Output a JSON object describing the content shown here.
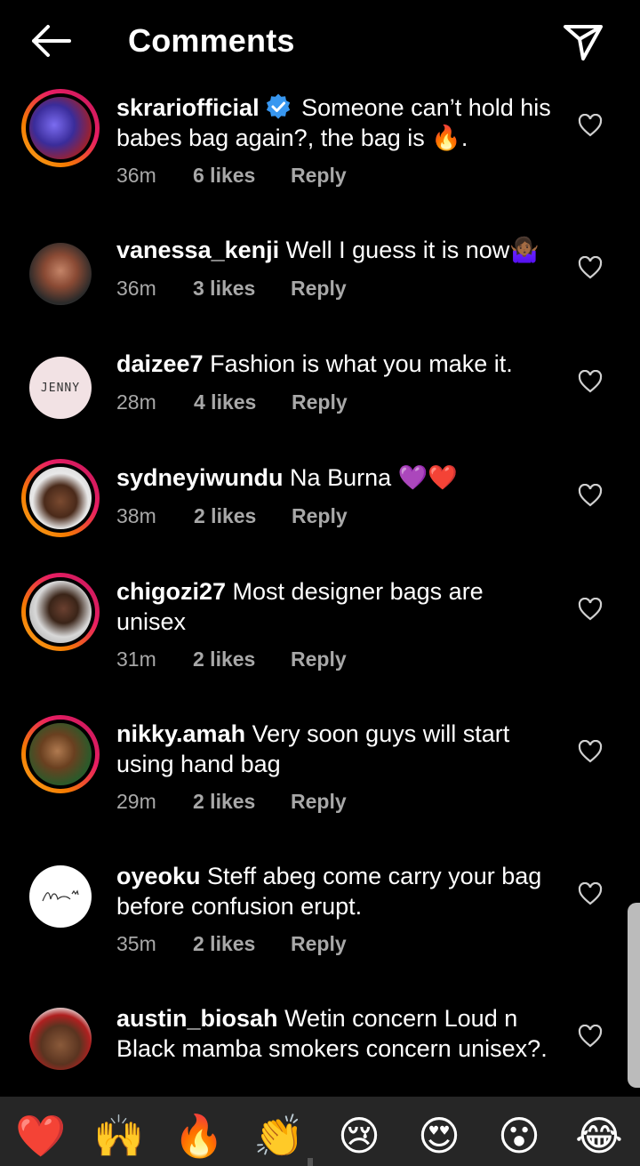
{
  "header": {
    "title": "Comments",
    "back_icon": "arrow-left-icon",
    "send_icon": "send-icon"
  },
  "comments": [
    {
      "username": "skrariofficial",
      "verified": true,
      "text": "Someone can’t hold his babes bag again?, the bag is 🔥.",
      "time": "36m",
      "likes": "6 likes",
      "reply": "Reply"
    },
    {
      "username": "vanessa_kenji",
      "verified": false,
      "text": "Well I guess it is now🤷🏾‍♀️",
      "time": "36m",
      "likes": "3 likes",
      "reply": "Reply"
    },
    {
      "username": "daizee7",
      "verified": false,
      "text": "Fashion is what you make it.",
      "time": "28m",
      "likes": "4 likes",
      "reply": "Reply",
      "avatar_text": "JENNY"
    },
    {
      "username": "sydneyiwundu",
      "verified": false,
      "text": "Na Burna 💜❤️",
      "time": "38m",
      "likes": "2 likes",
      "reply": "Reply"
    },
    {
      "username": "chigozi27",
      "verified": false,
      "text": "Most designer bags are unisex",
      "time": "31m",
      "likes": "2 likes",
      "reply": "Reply"
    },
    {
      "username": "nikky.amah",
      "verified": false,
      "text": "Very soon guys will start using hand bag",
      "time": "29m",
      "likes": "2 likes",
      "reply": "Reply"
    },
    {
      "username": "oyeoku",
      "verified": false,
      "text": "Steff abeg come carry your bag before confusion erupt.",
      "time": "35m",
      "likes": "2 likes",
      "reply": "Reply"
    },
    {
      "username": "austin_biosah",
      "verified": false,
      "text": "Wetin concern Loud n Black mamba smokers concern unisex?.",
      "time": "",
      "likes": "",
      "reply": ""
    }
  ],
  "reactions": [
    "❤️",
    "🙌",
    "🔥",
    "👏",
    "😢",
    "😍",
    "😮",
    "😂"
  ],
  "colors": {
    "background": "#000000",
    "meta": "#a8a8a8",
    "verified": "#3897f0",
    "bar": "#262626"
  }
}
